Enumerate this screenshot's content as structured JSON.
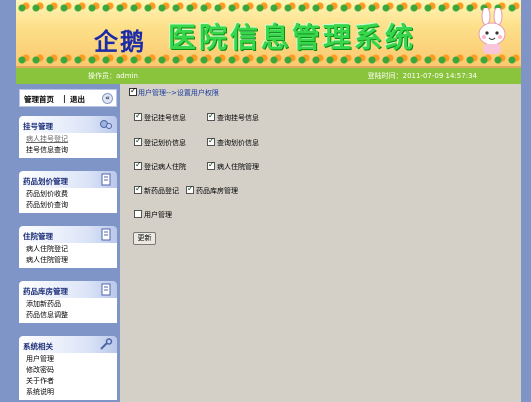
{
  "banner": {
    "brand": "企鹅",
    "system_title": "医院信息管理系统"
  },
  "status": {
    "operator": "操作员：admin",
    "login_time": "登陆时间：2011-07-09 14:57:34"
  },
  "sidebar": {
    "home": "管理首页",
    "separator": "|",
    "logout": "退出",
    "collapse_glyph": "«",
    "sections": [
      {
        "title": "挂号管理",
        "items": [
          "病人挂号登记",
          "挂号信息查询"
        ]
      },
      {
        "title": "药品划价管理",
        "items": [
          "药品划价收费",
          "药品划价查询"
        ]
      },
      {
        "title": "住院管理",
        "items": [
          "病人住院登记",
          "病人住院管理"
        ]
      },
      {
        "title": "药品库房管理",
        "items": [
          "添加新药品",
          "药品信息调整"
        ]
      },
      {
        "title": "系统相关",
        "items": [
          "用户管理",
          "修改密码",
          "关于作者",
          "系统说明"
        ]
      }
    ]
  },
  "main": {
    "breadcrumb": "用户管理-->设置用户权限",
    "permissions": [
      {
        "label": "登记挂号信息",
        "checked": true
      },
      {
        "label": "查询挂号信息",
        "checked": true
      },
      {
        "label": "登记划价信息",
        "checked": true
      },
      {
        "label": "查询划价信息",
        "checked": true
      },
      {
        "label": "登记病人住院",
        "checked": true
      },
      {
        "label": "病人住院管理",
        "checked": true
      },
      {
        "label": "新药品登记",
        "checked": true
      },
      {
        "label": "药品库房管理",
        "checked": true
      },
      {
        "label": "用户管理",
        "checked": false
      }
    ],
    "update_button": "更新"
  },
  "colors": {
    "page_bg": "#7f95c8",
    "status_green": "#8ac43c",
    "content_bg": "#d4d0c8",
    "title_green": "#38d64a",
    "brand_blue": "#1a2aa8"
  }
}
